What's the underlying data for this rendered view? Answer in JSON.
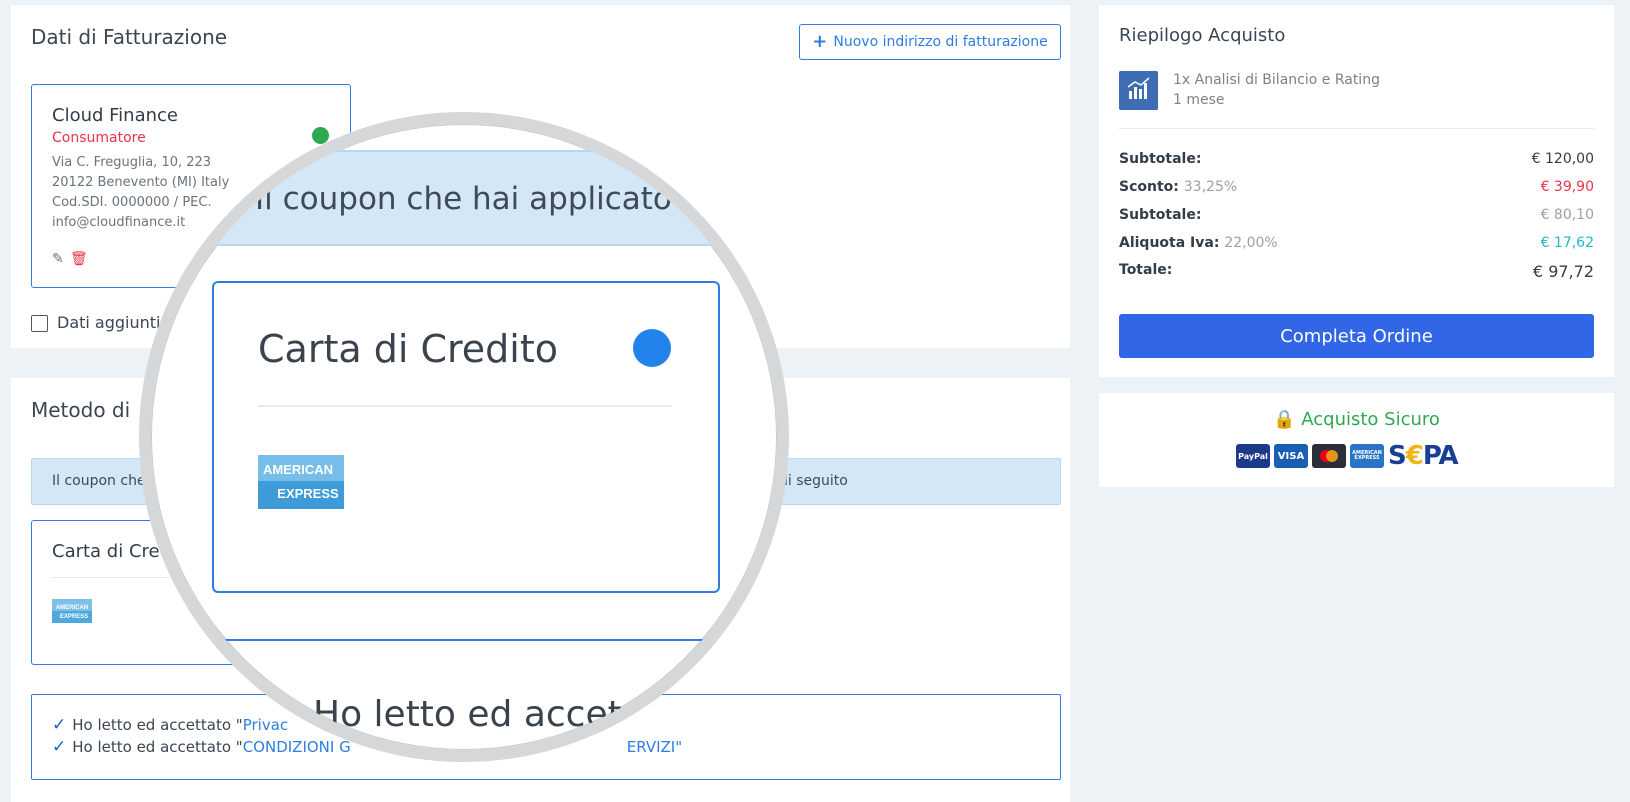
{
  "billing": {
    "title": "Dati di Fatturazione",
    "new_address_label": "Nuovo indirizzo di fatturazione",
    "card": {
      "name": "Cloud Finance",
      "type": "Consumatore",
      "lines": [
        "Via C. Freguglia, 10, 223",
        "20122 Benevento (MI) Italy",
        "Cod.SDI. 0000000 / PEC.",
        "info@cloudfinance.it"
      ]
    },
    "extra_checkbox_label": "Dati aggiunti"
  },
  "payment": {
    "title": "Metodo di",
    "coupon_text_left": "Il coupon che",
    "coupon_text_right": "di seguito",
    "card_title": "Carta di Cre",
    "terms": [
      {
        "prefix": "Ho letto ed accettato \"",
        "link": "Privac"
      },
      {
        "prefix": "Ho letto ed accettato \"",
        "link": "CONDIZIONI G",
        "suffix": "ERVIZI\""
      }
    ]
  },
  "magnifier": {
    "coupon_text": "Il coupon che hai applicato d",
    "card_title": "Carta di Credito",
    "amex_top": "AMERICAN",
    "amex_bottom": "EXPRESS",
    "terms_text": "Ho letto ed accet"
  },
  "summary": {
    "title": "Riepilogo Acquisto",
    "product_line1": "1x Analisi di Bilancio e Rating",
    "product_line2": "1 mese",
    "rows": [
      {
        "label": "Subtotale:",
        "extra": "",
        "value": "€ 120,00"
      },
      {
        "label": "Sconto:",
        "extra": "33,25%",
        "value": "€ 39,90"
      },
      {
        "label": "Subtotale:",
        "extra": "",
        "value": "€ 80,10"
      },
      {
        "label": "Aliquota Iva:",
        "extra": "22,00%",
        "value": "€ 17,62"
      },
      {
        "label": "Totale:",
        "extra": "",
        "value": "€ 97,72"
      }
    ],
    "complete_label": "Completa Ordine"
  },
  "secure": {
    "title": "Acquisto Sicuro",
    "logos": [
      "PayPal",
      "VISA",
      "AMERICAN EXPRESS"
    ],
    "sepa_s": "S",
    "sepa_euro": "€",
    "sepa_pa": "PA"
  },
  "colors": {
    "accent": "#2f7de1",
    "primary_button": "#3166e6",
    "danger": "#e8334a",
    "success": "#2fa84f",
    "teal": "#1fbac4"
  }
}
